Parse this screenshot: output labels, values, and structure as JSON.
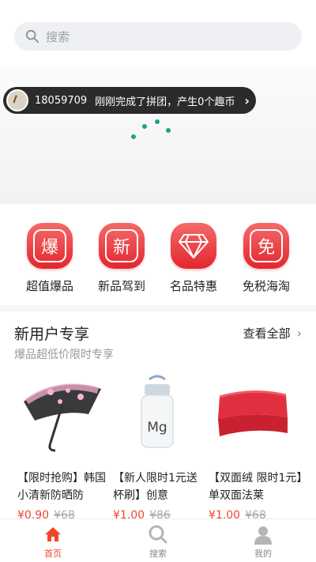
{
  "search": {
    "placeholder": "搜索"
  },
  "toast": {
    "user_id": "18059709",
    "message": "刚刚完成了拼团，产生0个趣币"
  },
  "categories": [
    {
      "icon_char": "爆",
      "label": "超值爆品"
    },
    {
      "icon_char": "新",
      "label": "新品驾到"
    },
    {
      "icon_char": "",
      "label": "名品特惠"
    },
    {
      "icon_char": "免",
      "label": "免税海淘"
    }
  ],
  "section": {
    "title": "新用户专享",
    "subtitle": "爆品超低价限时专享",
    "see_all": "查看全部"
  },
  "products": [
    {
      "name": "【限时抢购】韩国小清新防晒防",
      "price": "¥0.90",
      "old_price": "¥68"
    },
    {
      "name": "【新人限时1元送杯刷】创意",
      "price": "¥1.00",
      "old_price": "¥86"
    },
    {
      "name": "【双面绒 限时1元】单双面法莱",
      "price": "¥1.00",
      "old_price": "¥68"
    }
  ],
  "tabbar": [
    {
      "label": "首页",
      "icon": "home-icon",
      "active": true
    },
    {
      "label": "搜索",
      "icon": "search-icon",
      "active": false
    },
    {
      "label": "我的",
      "icon": "user-icon",
      "active": false
    }
  ],
  "colors": {
    "accent": "#f2442c",
    "category_red": "#e3262d",
    "loader": "#1ea18a"
  }
}
